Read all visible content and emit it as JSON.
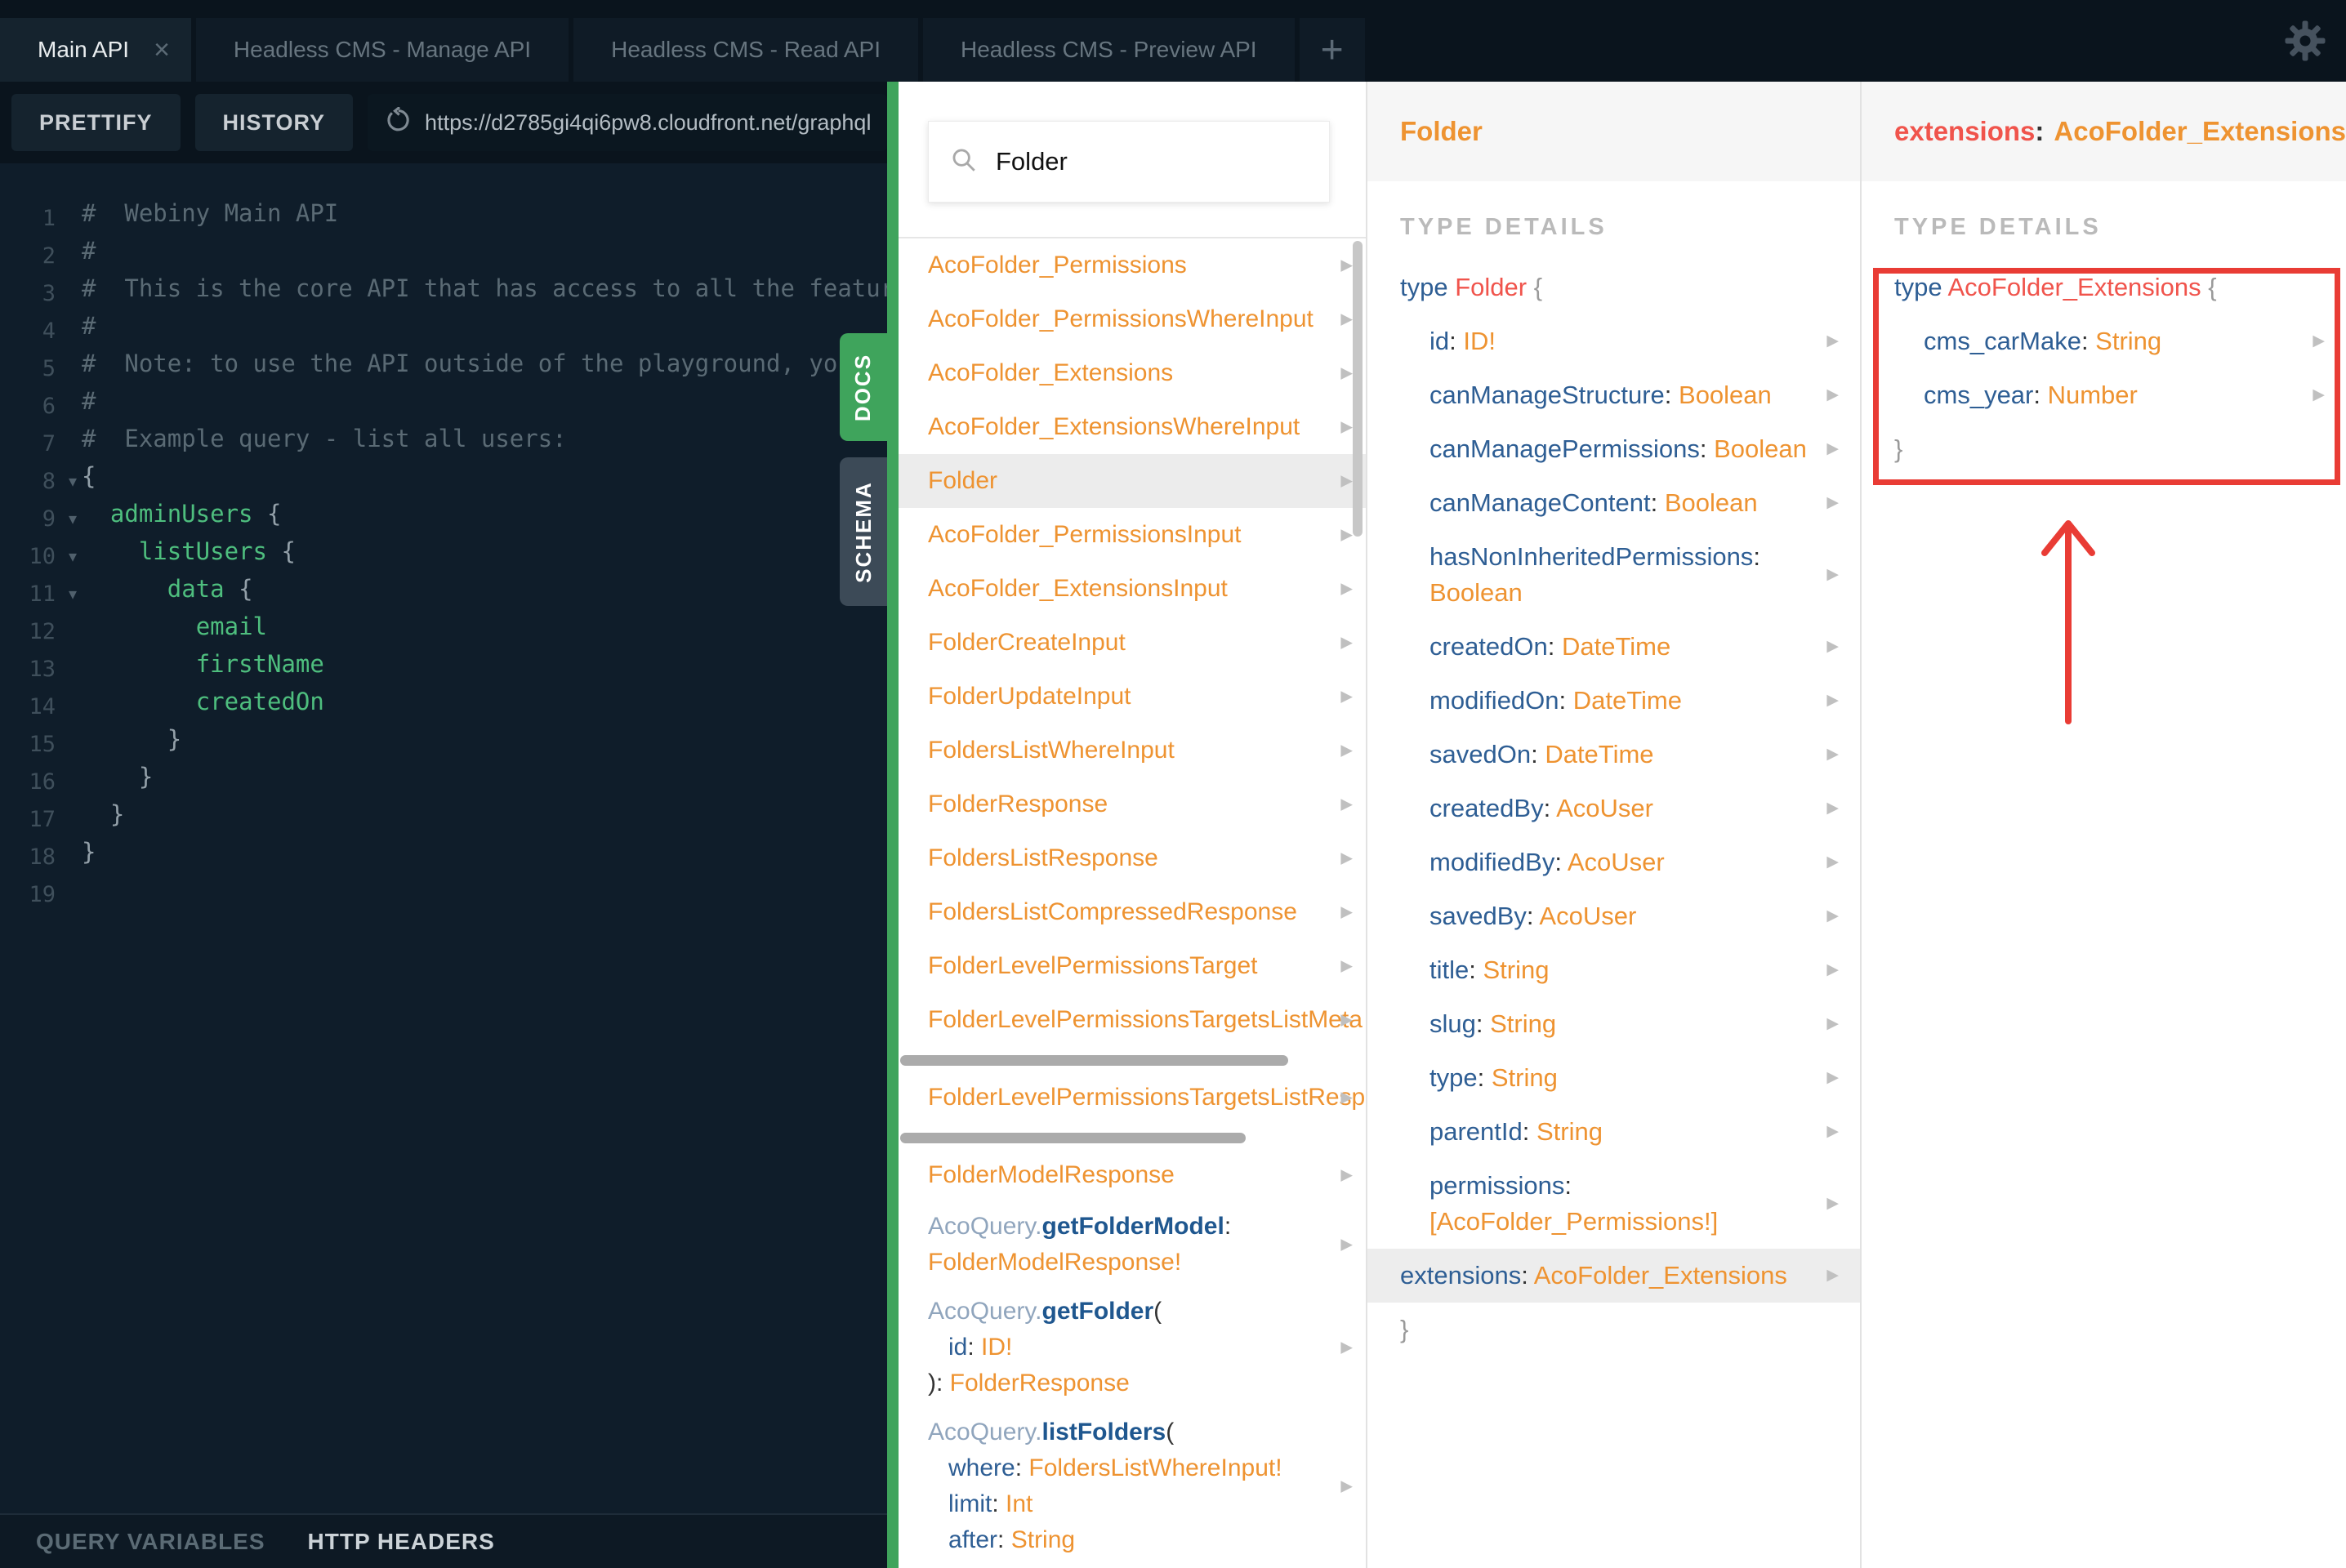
{
  "topbar": {
    "tabs": [
      {
        "label": "Main API",
        "active": true,
        "closable": true
      },
      {
        "label": "Headless CMS - Manage API"
      },
      {
        "label": "Headless CMS - Read API"
      },
      {
        "label": "Headless CMS - Preview API"
      }
    ],
    "new_tab_label": "+"
  },
  "toolbar": {
    "prettify_label": "PRETTIFY",
    "history_label": "HISTORY",
    "endpoint_url": "https://d2785gi4qi6pw8.cloudfront.net/graphql"
  },
  "editor": {
    "lines": [
      {
        "n": 1,
        "tokens": [
          {
            "c": "com",
            "t": "#  Webiny Main API"
          }
        ]
      },
      {
        "n": 2,
        "tokens": [
          {
            "c": "com",
            "t": "#"
          }
        ]
      },
      {
        "n": 3,
        "tokens": [
          {
            "c": "com",
            "t": "#  This is the core API that has access to all the featur"
          }
        ]
      },
      {
        "n": 4,
        "tokens": [
          {
            "c": "com",
            "t": "#"
          }
        ]
      },
      {
        "n": 5,
        "tokens": [
          {
            "c": "com",
            "t": "#  Note: to use the API outside of the playground, you"
          }
        ]
      },
      {
        "n": 6,
        "tokens": [
          {
            "c": "com",
            "t": "#"
          }
        ]
      },
      {
        "n": 7,
        "tokens": [
          {
            "c": "com",
            "t": "#  Example query - list all users:"
          }
        ]
      },
      {
        "n": 8,
        "fold": true,
        "tokens": [
          {
            "c": "pun",
            "t": "{"
          }
        ]
      },
      {
        "n": 9,
        "fold": true,
        "tokens": [
          {
            "c": "pun",
            "t": "  "
          },
          {
            "c": "fld",
            "t": "adminUsers"
          },
          {
            "c": "pun",
            "t": " {"
          }
        ]
      },
      {
        "n": 10,
        "fold": true,
        "tokens": [
          {
            "c": "pun",
            "t": "    "
          },
          {
            "c": "fld",
            "t": "listUsers"
          },
          {
            "c": "pun",
            "t": " {"
          }
        ]
      },
      {
        "n": 11,
        "fold": true,
        "tokens": [
          {
            "c": "pun",
            "t": "      "
          },
          {
            "c": "fld",
            "t": "data"
          },
          {
            "c": "pun",
            "t": " {"
          }
        ]
      },
      {
        "n": 12,
        "tokens": [
          {
            "c": "pun",
            "t": "        "
          },
          {
            "c": "fld",
            "t": "email"
          }
        ]
      },
      {
        "n": 13,
        "tokens": [
          {
            "c": "pun",
            "t": "        "
          },
          {
            "c": "fld",
            "t": "firstName"
          }
        ]
      },
      {
        "n": 14,
        "tokens": [
          {
            "c": "pun",
            "t": "        "
          },
          {
            "c": "fld",
            "t": "createdOn"
          }
        ]
      },
      {
        "n": 15,
        "tokens": [
          {
            "c": "pun",
            "t": "      }"
          }
        ]
      },
      {
        "n": 16,
        "tokens": [
          {
            "c": "pun",
            "t": "    }"
          }
        ]
      },
      {
        "n": 17,
        "tokens": [
          {
            "c": "pun",
            "t": "  }"
          }
        ]
      },
      {
        "n": 18,
        "tokens": [
          {
            "c": "pun",
            "t": "}"
          }
        ]
      },
      {
        "n": 19,
        "tokens": []
      }
    ]
  },
  "bottom_bar": {
    "query_variables": "QUERY VARIABLES",
    "http_headers": "HTTP HEADERS"
  },
  "side_tabs": {
    "docs": "DOCS",
    "schema": "SCHEMA"
  },
  "docs": {
    "search_value": "Folder",
    "items": [
      {
        "style": "type",
        "label": "AcoFolder_Permissions",
        "chevron": true
      },
      {
        "style": "type",
        "label": "AcoFolder_PermissionsWhereInput",
        "chevron": true
      },
      {
        "style": "type",
        "label": "AcoFolder_Extensions",
        "chevron": true
      },
      {
        "style": "type",
        "label": "AcoFolder_ExtensionsWhereInput",
        "chevron": true
      },
      {
        "style": "type",
        "label": "Folder",
        "chevron": true,
        "selected": true
      },
      {
        "style": "type",
        "label": "AcoFolder_PermissionsInput",
        "chevron": true
      },
      {
        "style": "type",
        "label": "AcoFolder_ExtensionsInput",
        "chevron": true
      },
      {
        "style": "type",
        "label": "FolderCreateInput",
        "chevron": true
      },
      {
        "style": "type",
        "label": "FolderUpdateInput",
        "chevron": true
      },
      {
        "style": "type",
        "label": "FoldersListWhereInput",
        "chevron": true
      },
      {
        "style": "type",
        "label": "FolderResponse",
        "chevron": true
      },
      {
        "style": "type",
        "label": "FoldersListResponse",
        "chevron": true
      },
      {
        "style": "type",
        "label": "FoldersListCompressedResponse",
        "chevron": true
      },
      {
        "style": "type",
        "label": "FolderLevelPermissionsTarget",
        "chevron": true
      },
      {
        "style": "type",
        "label": "FolderLevelPermissionsTargetsListMeta",
        "chevron": true
      },
      {
        "style": "hscrollbar",
        "width_pct": 83
      },
      {
        "style": "type",
        "label": "FolderLevelPermissionsTargetsListRespo",
        "chevron": true
      },
      {
        "style": "hscrollbar",
        "width_pct": 74
      },
      {
        "style": "type",
        "label": "FolderModelResponse",
        "chevron": true
      },
      {
        "style": "query",
        "chevron": true,
        "lines": [
          [
            {
              "c": "qprefix",
              "t": "AcoQuery."
            },
            {
              "c": "qmethod",
              "t": "getFolderModel"
            },
            {
              "c": "colon",
              "t": ":"
            }
          ],
          [
            {
              "c": "type",
              "t": "FolderModelResponse!"
            }
          ]
        ]
      },
      {
        "style": "query",
        "chevron": true,
        "lines": [
          [
            {
              "c": "qprefix",
              "t": "AcoQuery."
            },
            {
              "c": "qmethod",
              "t": "getFolder"
            },
            {
              "c": "colon",
              "t": "("
            }
          ],
          [
            {
              "c": "colon",
              "t": "   "
            },
            {
              "c": "fname",
              "t": "id"
            },
            {
              "c": "colon",
              "t": ": "
            },
            {
              "c": "type",
              "t": "ID!"
            }
          ],
          [
            {
              "c": "colon",
              "t": "): "
            },
            {
              "c": "type",
              "t": "FolderResponse"
            }
          ]
        ]
      },
      {
        "style": "query",
        "chevron": true,
        "lines": [
          [
            {
              "c": "qprefix",
              "t": "AcoQuery."
            },
            {
              "c": "qmethod",
              "t": "listFolders"
            },
            {
              "c": "colon",
              "t": "("
            }
          ],
          [
            {
              "c": "colon",
              "t": "   "
            },
            {
              "c": "fname",
              "t": "where"
            },
            {
              "c": "colon",
              "t": ": "
            },
            {
              "c": "type",
              "t": "FoldersListWhereInput!"
            }
          ],
          [
            {
              "c": "colon",
              "t": "   "
            },
            {
              "c": "fname",
              "t": "limit"
            },
            {
              "c": "colon",
              "t": ": "
            },
            {
              "c": "type",
              "t": "Int"
            }
          ],
          [
            {
              "c": "colon",
              "t": "   "
            },
            {
              "c": "fname",
              "t": "after"
            },
            {
              "c": "colon",
              "t": ": "
            },
            {
              "c": "type",
              "t": "String"
            }
          ]
        ]
      }
    ]
  },
  "folder_panel": {
    "title": "Folder",
    "section_label": "TYPE DETAILS",
    "type_keyword": "type",
    "type_name": "Folder",
    "open_brace": "{",
    "close_brace": "}",
    "fields": [
      {
        "name": "id",
        "type": "ID!"
      },
      {
        "name": "canManageStructure",
        "type": "Boolean"
      },
      {
        "name": "canManagePermissions",
        "type": "Boolean"
      },
      {
        "name": "canManageContent",
        "type": "Boolean"
      },
      {
        "name": "hasNonInheritedPermissions",
        "type": "Boolean"
      },
      {
        "name": "createdOn",
        "type": "DateTime"
      },
      {
        "name": "modifiedOn",
        "type": "DateTime"
      },
      {
        "name": "savedOn",
        "type": "DateTime"
      },
      {
        "name": "createdBy",
        "type": "AcoUser"
      },
      {
        "name": "modifiedBy",
        "type": "AcoUser"
      },
      {
        "name": "savedBy",
        "type": "AcoUser"
      },
      {
        "name": "title",
        "type": "String"
      },
      {
        "name": "slug",
        "type": "String"
      },
      {
        "name": "type",
        "type": "String"
      },
      {
        "name": "parentId",
        "type": "String"
      },
      {
        "name": "permissions",
        "type": "[AcoFolder_Permissions!]"
      },
      {
        "name": "extensions",
        "type": "AcoFolder_Extensions",
        "selected": true
      }
    ]
  },
  "extensions_panel": {
    "header_field": "extensions",
    "header_sep": ":",
    "header_type": "AcoFolder_Extensions",
    "section_label": "TYPE DETAILS",
    "type_keyword": "type",
    "type_name": "AcoFolder_Extensions",
    "open_brace": "{",
    "close_brace": "}",
    "fields": [
      {
        "name": "cms_carMake",
        "type": "String"
      },
      {
        "name": "cms_year",
        "type": "Number"
      }
    ]
  },
  "colors": {
    "accent_green": "#3fa45c",
    "type_orange": "#ee9331",
    "field_blue": "#2e5e94",
    "typename_red": "#f0544c",
    "annotation_red": "#e93c35",
    "editor_property_green": "#4ebe7e",
    "dark_background": "#0a141d"
  }
}
